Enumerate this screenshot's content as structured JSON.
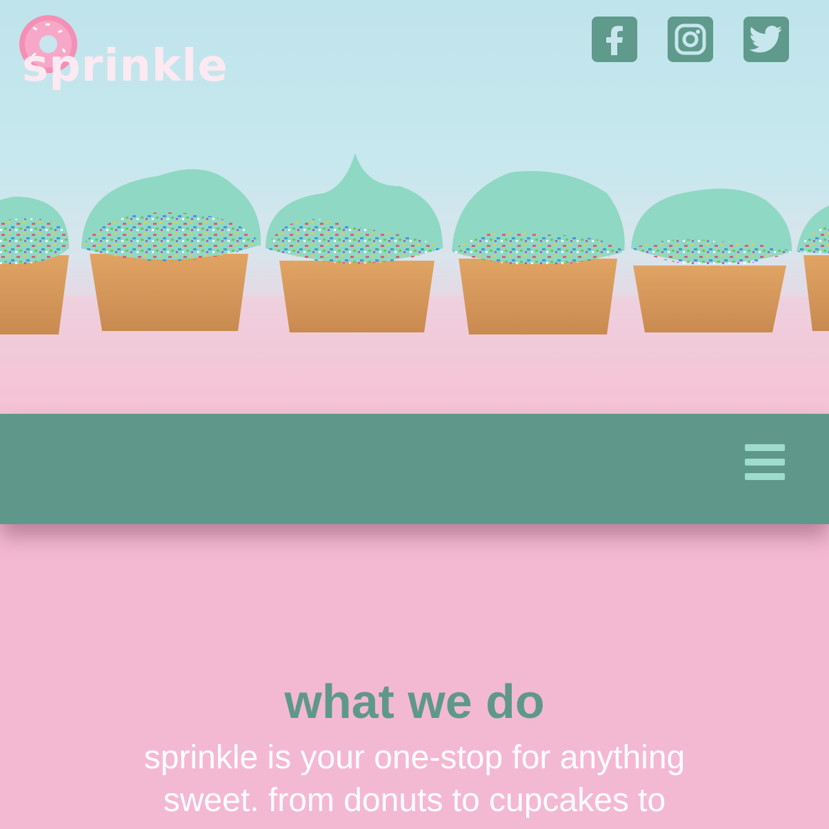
{
  "brand": {
    "name": "sprinkle",
    "primary_color": "#5f988b",
    "background_pink": "#f4b9d2",
    "hamburger_color": "#9fdccd"
  },
  "header": {
    "social": [
      {
        "name": "facebook-icon"
      },
      {
        "name": "instagram-icon"
      },
      {
        "name": "twitter-icon"
      }
    ]
  },
  "nav": {
    "menu_icon": "hamburger-menu-icon"
  },
  "section": {
    "title": "what we do",
    "body": "sprinkle is your one-stop for anything sweet. from donuts to cupcakes to"
  }
}
